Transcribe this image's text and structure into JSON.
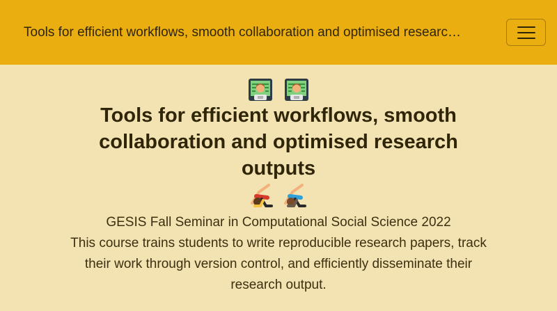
{
  "navbar": {
    "brand": "Tools for efficient workflows, smooth collaboration and optimised researc…",
    "menu_icon": "hamburger-icon"
  },
  "hero": {
    "top_icons": [
      "technologist-icon",
      "technologist-icon"
    ],
    "title": "Tools for efficient workflows, smooth collaboration and optimised research outputs",
    "bottom_icons": [
      "cartwheel-icon",
      "cartwheel-icon"
    ],
    "subtitle": "GESIS Fall Seminar in Computational Social Science 2022",
    "description": "This course trains students to write reproducible research papers, track their work through version control, and efficiently disseminate their research output."
  },
  "colors": {
    "navbar_bg": "#ebae10",
    "page_bg": "#f3e2b2",
    "text": "#2f2508"
  }
}
